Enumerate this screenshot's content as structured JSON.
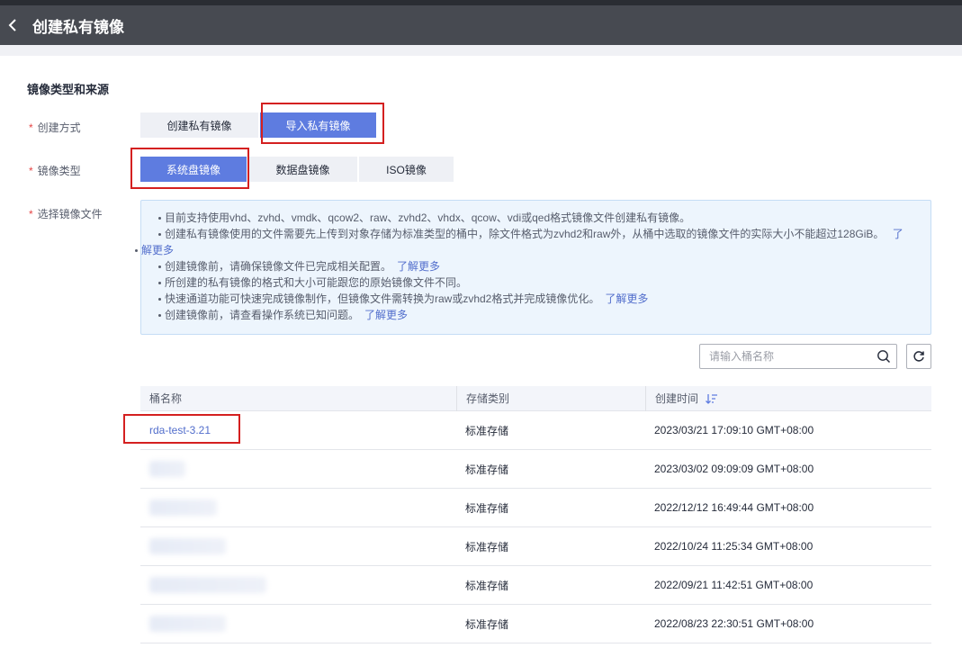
{
  "header": {
    "title": "创建私有镜像"
  },
  "section": {
    "title": "镜像类型和来源"
  },
  "form": {
    "method": {
      "label": "创建方式",
      "options": [
        "创建私有镜像",
        "导入私有镜像"
      ],
      "selected": "导入私有镜像"
    },
    "image_type": {
      "label": "镜像类型",
      "options": [
        "系统盘镜像",
        "数据盘镜像",
        "ISO镜像"
      ],
      "selected": "系统盘镜像"
    },
    "file": {
      "label": "选择镜像文件"
    }
  },
  "required_mark": "*",
  "tips": [
    {
      "text": "目前支持使用vhd、zvhd、vmdk、qcow2、raw、zvhd2、vhdx、qcow、vdi或qed格式镜像文件创建私有镜像。"
    },
    {
      "text": "创建私有镜像使用的文件需要先上传到对象存储为标准类型的桶中，除文件格式为zvhd2和raw外，从桶中选取的镜像文件的实际大小不能超过128GiB。",
      "link_line1": "了",
      "link_line2": "解更多"
    },
    {
      "text": "创建镜像前，请确保镜像文件已完成相关配置。",
      "link": "了解更多"
    },
    {
      "text": "所创建的私有镜像的格式和大小可能跟您的原始镜像文件不同。"
    },
    {
      "text": "快速通道功能可快速完成镜像制作，但镜像文件需转换为raw或zvhd2格式并完成镜像优化。",
      "link": "了解更多"
    },
    {
      "text": "创建镜像前，请查看操作系统已知问题。",
      "link": "了解更多"
    }
  ],
  "search": {
    "placeholder": "请输入桶名称",
    "value": ""
  },
  "table": {
    "columns": [
      "桶名称",
      "存储类别",
      "创建时间"
    ],
    "rows": [
      {
        "name": "rda-test-3.21",
        "storage": "标准存储",
        "created": "2023/03/21 17:09:10 GMT+08:00"
      },
      {
        "name": "",
        "storage": "标准存储",
        "created": "2023/03/02 09:09:09 GMT+08:00"
      },
      {
        "name": "",
        "storage": "标准存储",
        "created": "2022/12/12 16:49:44 GMT+08:00"
      },
      {
        "name": "",
        "storage": "标准存储",
        "created": "2022/10/24 11:25:34 GMT+08:00"
      },
      {
        "name": "",
        "storage": "标准存储",
        "created": "2022/09/21 11:42:51 GMT+08:00"
      },
      {
        "name": "",
        "storage": "标准存储",
        "created": "2022/08/23 22:30:51 GMT+08:00"
      }
    ]
  },
  "colors": {
    "accent": "#5e7ce0",
    "link": "#526ecc",
    "highlight_box": "#d42020",
    "header_bg": "#474a51"
  },
  "icons": {
    "back": "chevron-left-icon",
    "search": "search-icon",
    "refresh": "refresh-icon",
    "sort": "sort-descending-icon"
  }
}
